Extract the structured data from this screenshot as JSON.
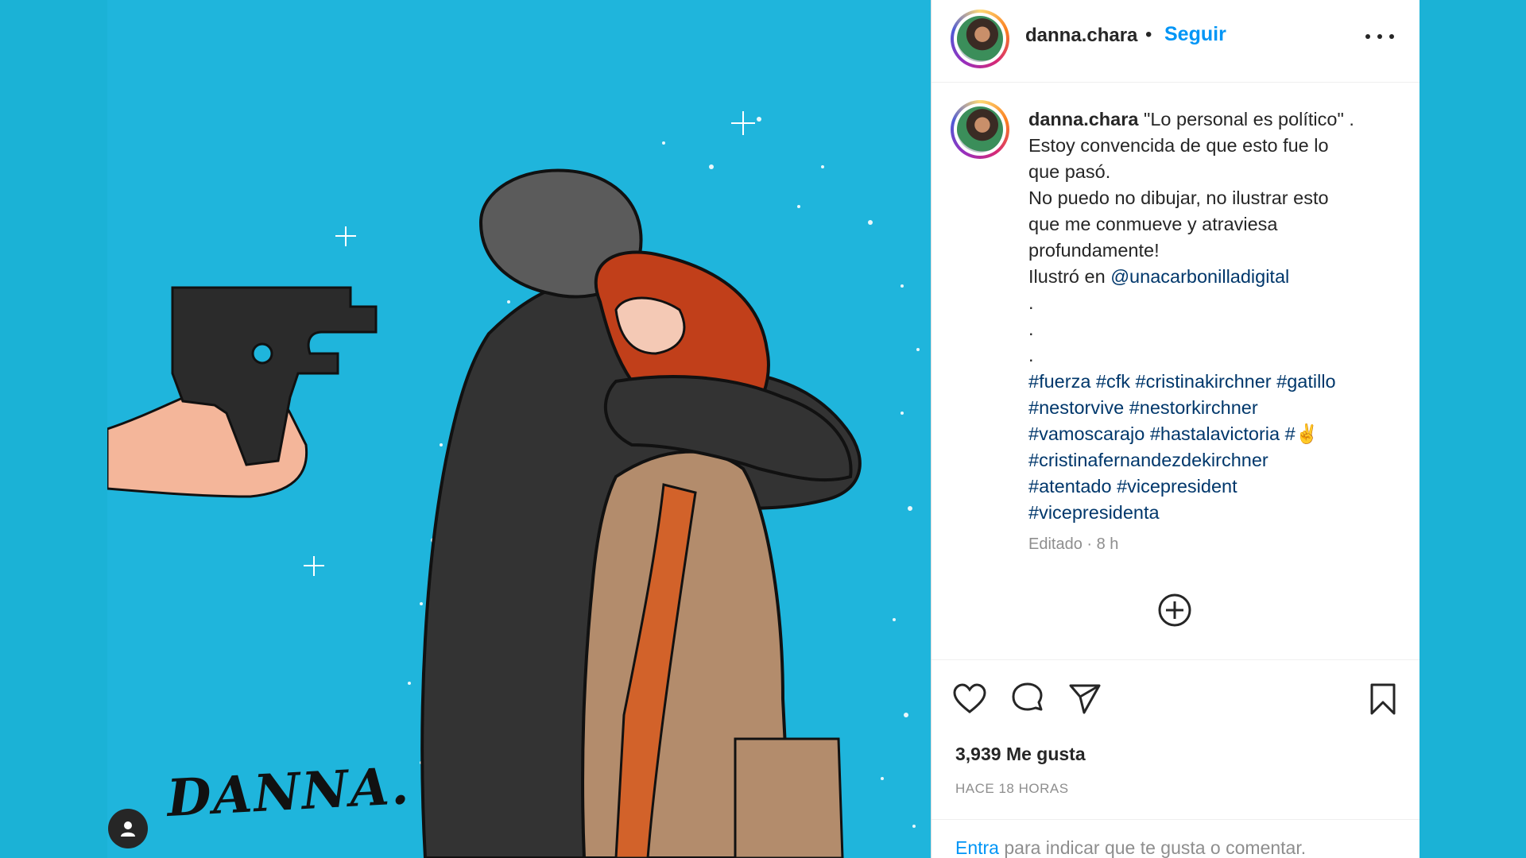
{
  "post": {
    "image_alt": "Ilustración DANNA",
    "signature": "DANNA."
  },
  "header": {
    "username": "danna.chara",
    "separator": "•",
    "follow_label": "Seguir",
    "more_icon": "more-horizontal-icon"
  },
  "caption": {
    "username": "danna.chara",
    "line1": "\"Lo personal es político\" .",
    "line2": "Estoy convencida de que esto fue lo",
    "line3": "que pasó.",
    "line4": "No puedo no dibujar, no ilustrar esto",
    "line5": "que me conmueve y atraviesa",
    "line6": "profundamente!",
    "credit_prefix": "Ilustró en ",
    "credit_link": "@unacarbonilladigital",
    "dot1": ".",
    "dot2": ".",
    "dot3": ".",
    "tags_line1": "#fuerza #cfk #cristinakirchner #gatillo",
    "tags_line2": "#nestorvive #nestorkirchner",
    "tags_line3": "#vamoscarajo #hastalavictoria #✌",
    "tags_line4": "#cristinafernandezdekirchner",
    "tags_line5": "#atentado #vicepresident",
    "tags_line6": "#vicepresidenta",
    "meta": "Editado · 8 h"
  },
  "actions": {
    "likes": "3,939 Me gusta",
    "time": "HACE 18 HORAS",
    "login_link": "Entra",
    "login_rest": " para indicar que te gusta o comentar."
  },
  "colors": {
    "accent": "#0095f6",
    "background": "#1bb2d6",
    "link": "#00376b"
  }
}
